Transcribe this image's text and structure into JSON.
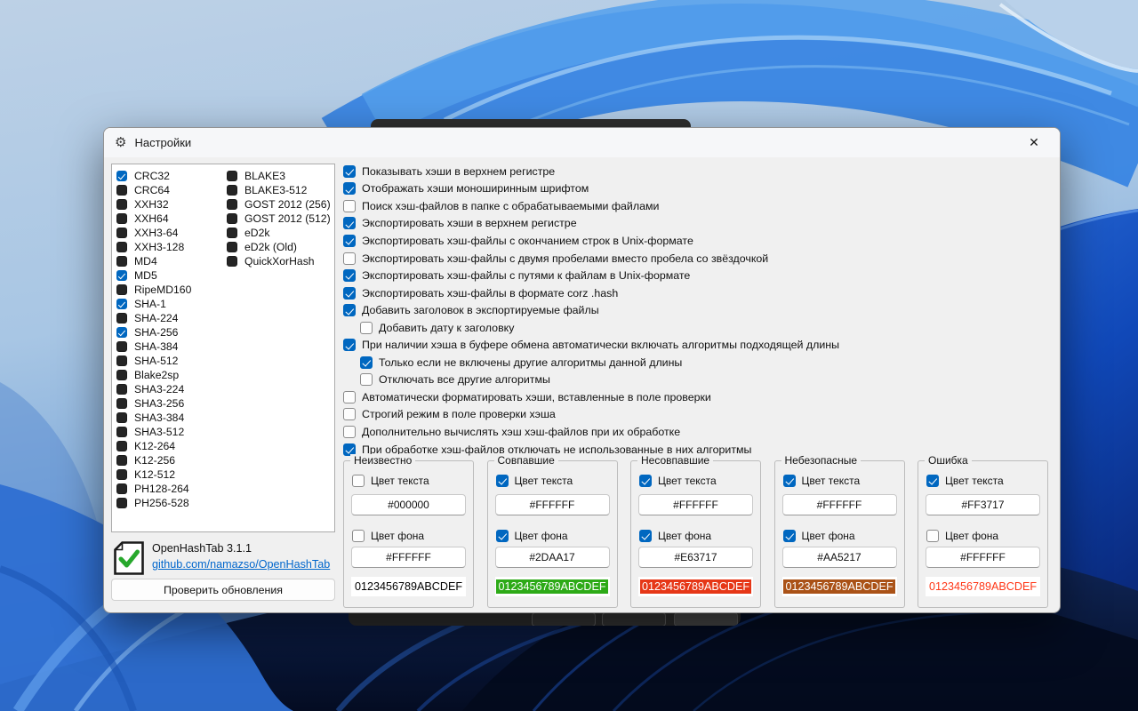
{
  "window": {
    "title": "Настройки"
  },
  "icons": {
    "gear": "⚙",
    "close": "✕"
  },
  "colors": {
    "accent": "#0067C0",
    "link": "#0066CC"
  },
  "algorithms": {
    "col1": [
      {
        "label": "CRC32",
        "checked": true
      },
      {
        "label": "CRC64",
        "checked": false
      },
      {
        "label": "XXH32",
        "checked": false
      },
      {
        "label": "XXH64",
        "checked": false
      },
      {
        "label": "XXH3-64",
        "checked": false
      },
      {
        "label": "XXH3-128",
        "checked": false
      },
      {
        "label": "MD4",
        "checked": false
      },
      {
        "label": "MD5",
        "checked": true
      },
      {
        "label": "RipeMD160",
        "checked": false
      },
      {
        "label": "SHA-1",
        "checked": true
      },
      {
        "label": "SHA-224",
        "checked": false
      },
      {
        "label": "SHA-256",
        "checked": true
      },
      {
        "label": "SHA-384",
        "checked": false
      },
      {
        "label": "SHA-512",
        "checked": false
      },
      {
        "label": "Blake2sp",
        "checked": false
      },
      {
        "label": "SHA3-224",
        "checked": false
      },
      {
        "label": "SHA3-256",
        "checked": false
      },
      {
        "label": "SHA3-384",
        "checked": false
      },
      {
        "label": "SHA3-512",
        "checked": false
      },
      {
        "label": "K12-264",
        "checked": false
      },
      {
        "label": "K12-256",
        "checked": false
      },
      {
        "label": "K12-512",
        "checked": false
      },
      {
        "label": "PH128-264",
        "checked": false
      },
      {
        "label": "PH256-528",
        "checked": false
      }
    ],
    "col2": [
      {
        "label": "BLAKE3",
        "checked": false
      },
      {
        "label": "BLAKE3-512",
        "checked": false
      },
      {
        "label": "GOST 2012 (256)",
        "checked": false
      },
      {
        "label": "GOST 2012 (512)",
        "checked": false
      },
      {
        "label": "eD2k",
        "checked": false
      },
      {
        "label": "eD2k (Old)",
        "checked": false
      },
      {
        "label": "QuickXorHash",
        "checked": false
      }
    ]
  },
  "options": [
    {
      "label": "Показывать хэши в верхнем регистре",
      "checked": true,
      "indent": false
    },
    {
      "label": "Отображать хэши моноширинным шрифтом",
      "checked": true,
      "indent": false
    },
    {
      "label": "Поиск хэш-файлов в папке с обрабатываемыми файлами",
      "checked": false,
      "indent": false
    },
    {
      "label": "Экспортировать хэши в верхнем регистре",
      "checked": true,
      "indent": false
    },
    {
      "label": "Экспортировать хэш-файлы с окончанием строк в Unix-формате",
      "checked": true,
      "indent": false
    },
    {
      "label": "Экспортировать хэш-файлы с двумя пробелами вместо пробела со звёздочкой",
      "checked": false,
      "indent": false
    },
    {
      "label": "Экспортировать хэш-файлы с путями к файлам в Unix-формате",
      "checked": true,
      "indent": false
    },
    {
      "label": "Экспортировать хэш-файлы в формате corz .hash",
      "checked": true,
      "indent": false
    },
    {
      "label": "Добавить заголовок в экспортируемые файлы",
      "checked": true,
      "indent": false
    },
    {
      "label": "Добавить дату к заголовку",
      "checked": false,
      "indent": true
    },
    {
      "label": "При наличии хэша в буфере обмена автоматически включать алгоритмы подходящей длины",
      "checked": true,
      "indent": false
    },
    {
      "label": "Только если не включены другие алгоритмы данной длины",
      "checked": true,
      "indent": true
    },
    {
      "label": "Отключать все другие алгоритмы",
      "checked": false,
      "indent": true
    },
    {
      "label": "Автоматически форматировать хэши, вставленные в поле проверки",
      "checked": false,
      "indent": false
    },
    {
      "label": "Строгий режим в поле проверки хэша",
      "checked": false,
      "indent": false
    },
    {
      "label": "Дополнительно вычислять хэш хэш-файлов при их обработке",
      "checked": false,
      "indent": false
    },
    {
      "label": "При обработке хэш-файлов отключать не использованные в них алгоритмы",
      "checked": true,
      "indent": false
    }
  ],
  "labels": {
    "text_color": "Цвет текста",
    "bg_color": "Цвет фона",
    "sample": "0123456789ABCDEF"
  },
  "color_groups": [
    {
      "title": "Неизвестно",
      "text_checked": false,
      "text_value": "#000000",
      "bg_checked": false,
      "bg_value": "#FFFFFF",
      "sample_fg": "#000000",
      "sample_bg": ""
    },
    {
      "title": "Совпавшие",
      "text_checked": true,
      "text_value": "#FFFFFF",
      "bg_checked": true,
      "bg_value": "#2DAA17",
      "sample_fg": "#FFFFFF",
      "sample_bg": "#2DAA17"
    },
    {
      "title": "Несовпавшие",
      "text_checked": true,
      "text_value": "#FFFFFF",
      "bg_checked": true,
      "bg_value": "#E63717",
      "sample_fg": "#FFFFFF",
      "sample_bg": "#E63717"
    },
    {
      "title": "Небезопасные",
      "text_checked": true,
      "text_value": "#FFFFFF",
      "bg_checked": true,
      "bg_value": "#AA5217",
      "sample_fg": "#FFFFFF",
      "sample_bg": "#AA5217"
    },
    {
      "title": "Ошибка",
      "text_checked": true,
      "text_value": "#FF3717",
      "bg_checked": false,
      "bg_value": "#FFFFFF",
      "sample_fg": "#FF3717",
      "sample_bg": ""
    }
  ],
  "about": {
    "name": "OpenHashTab 3.1.1",
    "link": "github.com/namazso/OpenHashTab",
    "update_button": "Проверить обновления"
  }
}
